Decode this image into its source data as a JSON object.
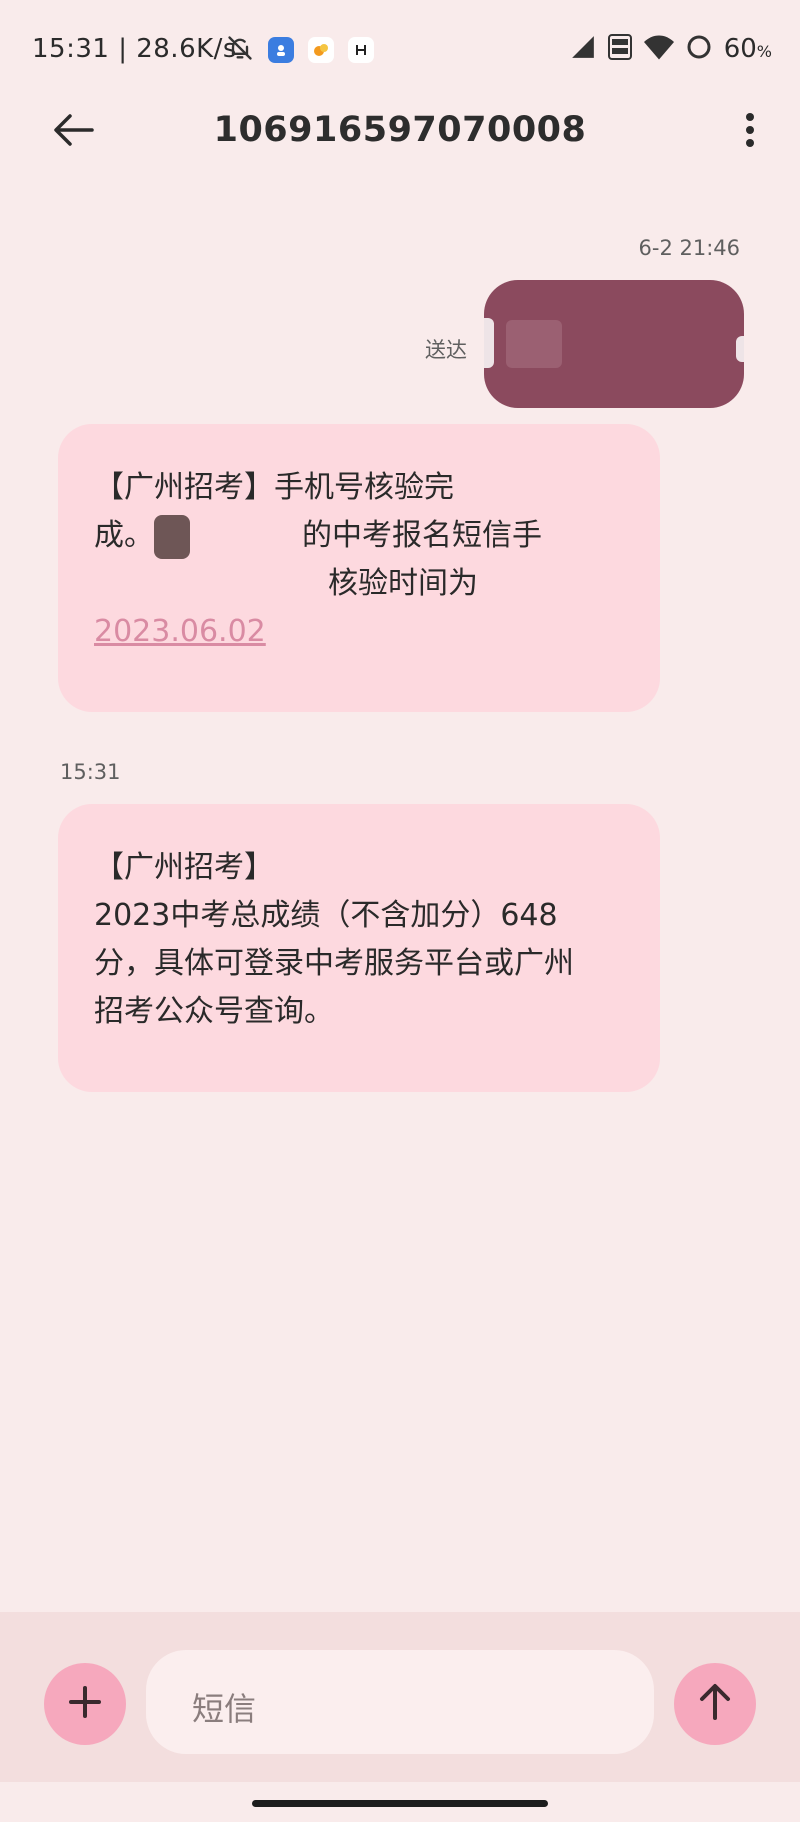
{
  "status_bar": {
    "time_speed": "15:31 | 28.6K/s",
    "battery": "60",
    "battery_unit": "%",
    "icons": [
      "bell-off-icon",
      "app-icon-blue",
      "app-icon-orange",
      "app-icon-white",
      "signal-icon",
      "volte-icon",
      "wifi-icon",
      "battery-ring-icon"
    ]
  },
  "header": {
    "title": "106916597070008",
    "back_icon": "arrow-left-icon",
    "more_icon": "more-vertical-icon"
  },
  "conversation": {
    "sent_timestamp": "6-2 21:46",
    "sent_status": "送达",
    "message1": {
      "line1": "【广州招考】手机号核验完",
      "line2_start": "成。",
      "line2_end": "的中考报名短信手",
      "line3_end": "核验时间为",
      "date_link": "2023.06.02"
    },
    "received_timestamp": "15:31",
    "message2": {
      "line1": "【广州招考】",
      "line2": "2023中考总成绩（不含加分）648",
      "line3": "分，具体可登录中考服务平台或广州",
      "line4": "招考公众号查询。"
    }
  },
  "composer": {
    "placeholder": "短信",
    "add_icon": "plus-icon",
    "send_icon": "arrow-up-icon"
  },
  "colors": {
    "background": "#f9ebeb",
    "received_bubble": "#fdd9df",
    "sent_bubble": "#8b4a5e",
    "accent_button": "#f6a8bd",
    "link": "#d98ba3"
  }
}
